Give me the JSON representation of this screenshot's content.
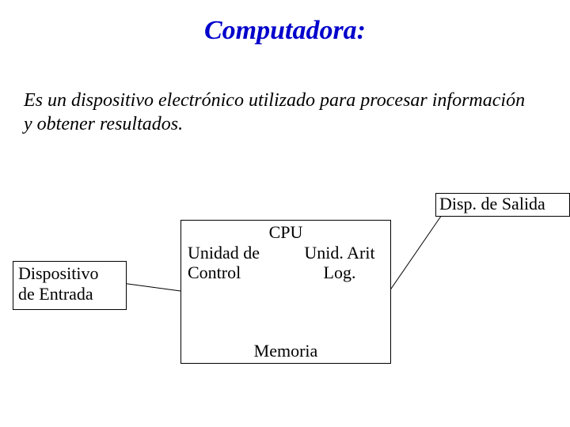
{
  "title": "Computadora:",
  "definition": "Es un dispositivo electrónico utilizado para procesar información y obtener resultados.",
  "diagram": {
    "input_box": "Dispositivo\nde Entrada",
    "output_box": "Disp. de Salida",
    "cpu_label": "CPU",
    "control_unit": "Unidad de\nControl",
    "alu": "Unid. Arit\nLog.",
    "memory": "Memoria"
  }
}
